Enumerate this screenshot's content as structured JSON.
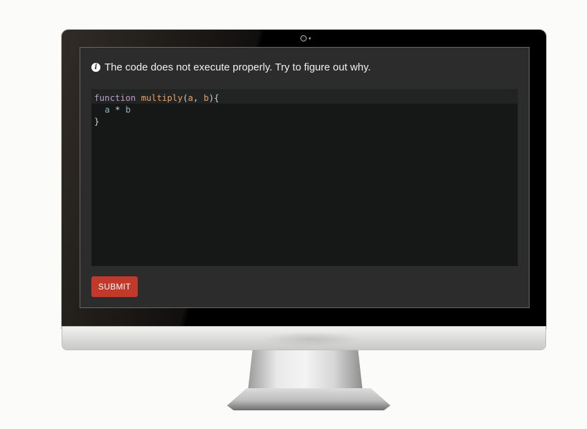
{
  "prompt": {
    "icon": "info-icon",
    "text": "The code does not execute properly. Try to figure out why."
  },
  "code": {
    "line1": {
      "keyword": "function",
      "name": "multiply",
      "open_paren": "(",
      "param1": "a",
      "comma": ", ",
      "param2": "b",
      "close": "){"
    },
    "line2": {
      "operand1": "a",
      "operator": "*",
      "operand2": "b"
    },
    "line3": {
      "brace": "}"
    }
  },
  "submit": {
    "label": "SUBMIT",
    "color": "#c0392b"
  },
  "colors": {
    "screen_bg": "#2c2c2c",
    "editor_bg": "#161818",
    "keyword": "#b99ec9",
    "function_name": "#e8a063",
    "variable": "#8fb3c9"
  }
}
